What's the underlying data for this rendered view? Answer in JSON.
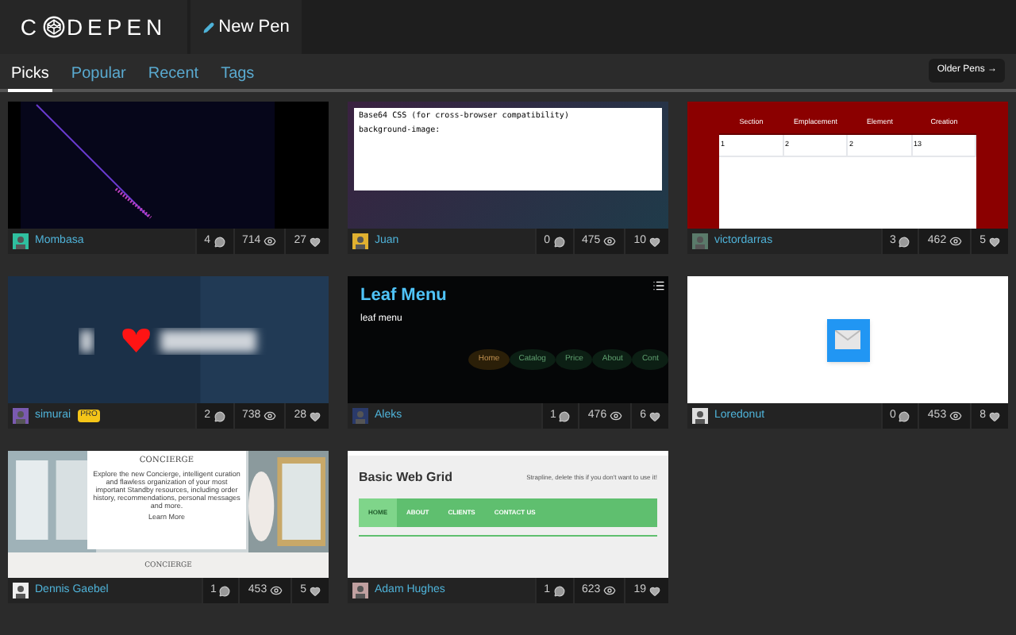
{
  "header": {
    "logo_left": "C",
    "logo_right": "DEPEN",
    "new_pen": "New Pen"
  },
  "tabs": [
    {
      "label": "Picks",
      "selected": true
    },
    {
      "label": "Popular",
      "selected": false
    },
    {
      "label": "Recent",
      "selected": false
    },
    {
      "label": "Tags",
      "selected": false
    }
  ],
  "older_button": "Older Pens →",
  "pens": [
    {
      "kind": "lines",
      "author": "Mombasa",
      "comments": "4",
      "views": "714",
      "hearts": "27"
    },
    {
      "kind": "code",
      "author": "Juan",
      "comments": "0",
      "views": "475",
      "hearts": "10",
      "preview": {
        "title": "Base64 CSS (for cross-browser compatibility)",
        "line": "background-image:"
      }
    },
    {
      "kind": "table",
      "author": "victordarras",
      "comments": "3",
      "views": "462",
      "hearts": "5",
      "preview": {
        "columns": [
          "Section",
          "Emplacement",
          "Element",
          "Creation"
        ],
        "row": [
          "1",
          "2",
          "2",
          "13"
        ]
      }
    },
    {
      "kind": "blur",
      "author": "simurai",
      "badge": "PRO",
      "comments": "2",
      "views": "738",
      "hearts": "28"
    },
    {
      "kind": "menu",
      "author": "Aleks",
      "comments": "1",
      "views": "476",
      "hearts": "6",
      "preview": {
        "title": "Leaf Menu",
        "subtitle": "leaf menu",
        "items": [
          "Home",
          "Catalog",
          "Price",
          "About",
          "Cont"
        ]
      }
    },
    {
      "kind": "icon",
      "author": "Loredonut",
      "comments": "0",
      "views": "453",
      "hearts": "8"
    },
    {
      "kind": "concierge",
      "author": "Dennis Gaebel",
      "comments": "1",
      "views": "453",
      "hearts": "5",
      "preview": {
        "title": "CONCIERGE",
        "body": "Explore the new Concierge, intelligent curation and flawless organization of your most important Standby resources, including order history, recommendations, personal messages and more.",
        "link": "Learn More",
        "footer": "CONCIERGE"
      }
    },
    {
      "kind": "grid",
      "author": "Adam Hughes",
      "comments": "1",
      "views": "623",
      "hearts": "19",
      "preview": {
        "title": "Basic Web Grid",
        "strapline": "Strapline, delete this if you don't want to use it!",
        "nav": [
          {
            "label": "HOME",
            "selected": true
          },
          {
            "label": "ABOUT",
            "selected": false
          },
          {
            "label": "CLIENTS",
            "selected": false
          },
          {
            "label": "CONTACT US",
            "selected": false
          }
        ]
      }
    }
  ]
}
